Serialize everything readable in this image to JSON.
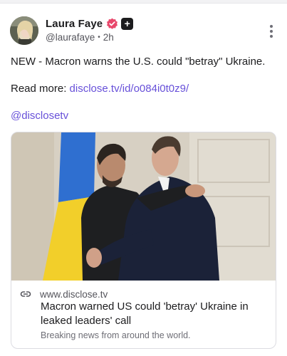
{
  "post": {
    "author": {
      "display_name": "Laura Faye",
      "handle": "@laurafaye",
      "time": "2h",
      "verified_badge_color": "#e8476b"
    },
    "text": {
      "headline": "NEW - Macron warns the U.S. could \"betray\" Ukraine.",
      "read_more_label": "Read more: ",
      "read_more_link": "disclose.tv/id/o084i0t0z9/",
      "mention": "@disclosetv"
    },
    "link_card": {
      "domain": "www.disclose.tv",
      "title": "Macron warned US could 'betray' Ukraine in leaked leaders' call",
      "description": "Breaking news from around the world."
    },
    "colors": {
      "link": "#6750d9",
      "text": "#1c1c1e",
      "muted": "#55555c"
    }
  }
}
